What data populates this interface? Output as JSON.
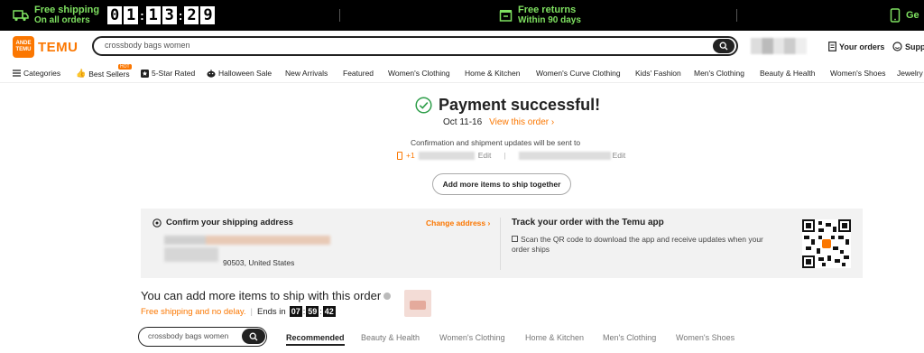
{
  "banner": {
    "shipping_line1": "Free shipping",
    "shipping_line2": "On all orders",
    "countdown": [
      "0",
      "1",
      "1",
      "3",
      "2",
      "9"
    ],
    "returns_line1": "Free returns",
    "returns_line2": "Within 90 days",
    "app_text": "Ge"
  },
  "header": {
    "logo_badge": "ANDE TEMU",
    "logo_text": "TEMU",
    "search_value": "crossbody bags women",
    "orders_label": "Your orders",
    "support_label": "Suppo"
  },
  "nav": {
    "items": [
      "Categories",
      "Best Sellers",
      "5-Star Rated",
      "Halloween Sale",
      "New Arrivals",
      "Featured",
      "Women's Clothing",
      "Home & Kitchen",
      "Women's Curve Clothing",
      "Kids' Fashion",
      "Men's Clothing",
      "Beauty & Health",
      "Women's Shoes",
      "Jewelry"
    ],
    "hot_badge": "HOT"
  },
  "payment": {
    "title": "Payment successful!",
    "dates": "Oct 11-16",
    "view_order": "View this order",
    "confirm_text": "Confirmation and shipment updates will be sent to",
    "phone_prefix": "+1",
    "edit1": "Edit",
    "edit2": "Edit",
    "add_more_button": "Add more items to ship together"
  },
  "shipping": {
    "title": "Confirm your shipping address",
    "change_link": "Change address",
    "address_tail": "90503, United States"
  },
  "track": {
    "title": "Track your order with the Temu app",
    "desc": "Scan the QR code to download the app and receive updates when your order ships"
  },
  "more": {
    "title": "You can add more items to ship with this order",
    "free_text": "Free shipping and no delay.",
    "ends_label": "Ends in",
    "timer": [
      "07",
      "59",
      "42"
    ]
  },
  "bottom": {
    "search_value": "crossbody bags women",
    "tabs": [
      "Recommended",
      "Beauty & Health",
      "Women's Clothing",
      "Home & Kitchen",
      "Men's Clothing",
      "Women's Shoes"
    ]
  },
  "colors": {
    "accent": "#fb7701",
    "banner_green": "#7ee060",
    "success_green": "#2e9e4a"
  }
}
